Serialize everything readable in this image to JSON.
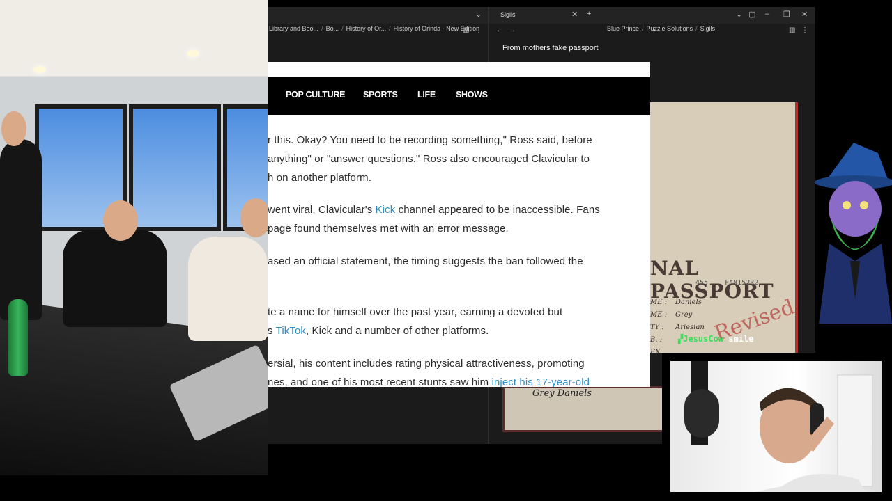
{
  "browser": {
    "left_tab_label": "",
    "right_tab_label": "Sigils",
    "left_path": [
      "Library and Boo...",
      "Bo...",
      "History of Or...",
      "History of Orinda - New Edition"
    ],
    "right_path": [
      "Blue Prince",
      "Puzzle Solutions",
      "Sigils"
    ],
    "note_title": "From mothers fake passport"
  },
  "passport": {
    "title": "NAL PASSPORT",
    "number_left": "455",
    "number_right": "FA815232",
    "rows": [
      {
        "key": "ME :",
        "value": "Daniels"
      },
      {
        "key": "ME :",
        "value": "Grey"
      },
      {
        "key": "TY :",
        "value": "Ariesian"
      },
      {
        "key": "B. :",
        "value": ""
      },
      {
        "key": "EX",
        "value": ""
      }
    ],
    "stamp": "Revised",
    "signature": "Grey Daniels"
  },
  "article": {
    "nav": [
      "POP CULTURE",
      "SPORTS",
      "LIFE",
      "SHOWS"
    ],
    "lines": [
      {
        "text": "r this. Okay? You need to be recording something,\" Ross said, before"
      },
      {
        "text": "anything\" or \"answer questions.\" Ross also encouraged Clavicular to"
      },
      {
        "text": "h on another platform."
      },
      {
        "pre": "went viral, Clavicular's ",
        "link": "Kick",
        "post": " channel appeared to be inaccessible. Fans"
      },
      {
        "text": "page found themselves met with an error message."
      },
      {
        "text": "ased an official statement, the timing suggests the ban followed the"
      },
      {
        "text": "te a name for himself over the past year, earning a devoted but"
      },
      {
        "pre": "s ",
        "link": "TikTok",
        "post": ", Kick and a number of other platforms."
      },
      {
        "text": "ersial, his content includes rating physical attractiveness, promoting"
      },
      {
        "pre": "nes, and one of his most recent stunts saw him ",
        "link": "inject his 17-year-old",
        "post": ""
      }
    ]
  },
  "chat": {
    "username": "JesusCow",
    "message": "smile",
    "username_color": "#39e05a",
    "message_color": "#ffffff"
  }
}
